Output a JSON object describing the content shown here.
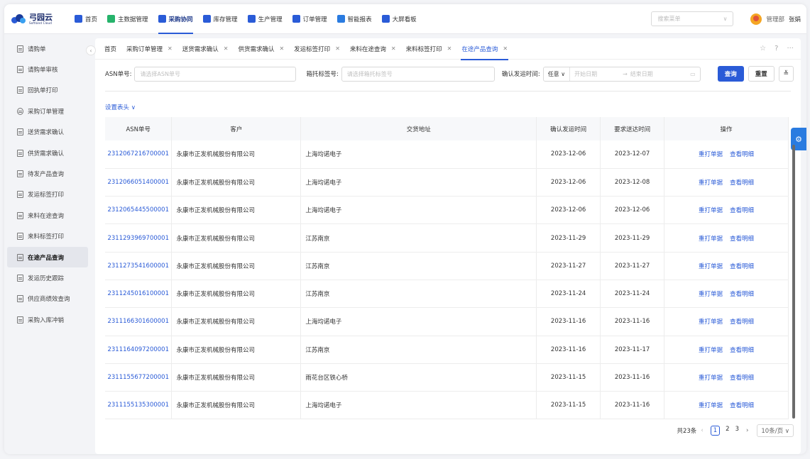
{
  "app": {
    "logo_text": "弓园云",
    "logo_sub": "Softland Cloud"
  },
  "topnav": {
    "items": [
      {
        "label": "首页",
        "icon": "home-icon",
        "color": "#2a5bd7"
      },
      {
        "label": "主数据管理",
        "icon": "database-icon",
        "color": "#26b36b"
      },
      {
        "label": "采购协同",
        "icon": "cart-icon",
        "color": "#2a5bd7"
      },
      {
        "label": "库存管理",
        "icon": "warehouse-icon",
        "color": "#2a5bd7"
      },
      {
        "label": "生产管理",
        "icon": "factory-icon",
        "color": "#2a5bd7"
      },
      {
        "label": "订单管理",
        "icon": "order-icon",
        "color": "#2a5bd7"
      },
      {
        "label": "智能报表",
        "icon": "report-icon",
        "color": "#2a7be0"
      },
      {
        "label": "大屏看板",
        "icon": "dashboard-icon",
        "color": "#2a5bd7"
      }
    ],
    "active_index": 2,
    "search_placeholder": "搜索菜单",
    "dept": "管理部",
    "user": "张娟"
  },
  "sidebar": {
    "items": [
      {
        "label": "请购单"
      },
      {
        "label": "请购单审核"
      },
      {
        "label": "回执单打印"
      },
      {
        "label": "采购订单管理"
      },
      {
        "label": "送货需求确认"
      },
      {
        "label": "供货需求确认"
      },
      {
        "label": "待发产品查询"
      },
      {
        "label": "发运标签打印"
      },
      {
        "label": "来料在途查询"
      },
      {
        "label": "来料标签打印"
      },
      {
        "label": "在途产品查询"
      },
      {
        "label": "发运历史跟踪"
      },
      {
        "label": "供应商绩效查询"
      },
      {
        "label": "采购入库冲销"
      }
    ],
    "active_index": 10
  },
  "tabs": {
    "items": [
      {
        "label": "首页",
        "closable": false
      },
      {
        "label": "采购订单管理",
        "closable": true
      },
      {
        "label": "送货需求确认",
        "closable": true
      },
      {
        "label": "供货需求确认",
        "closable": true
      },
      {
        "label": "发运标签打印",
        "closable": true
      },
      {
        "label": "来料在途查询",
        "closable": true
      },
      {
        "label": "来料标签打印",
        "closable": true
      },
      {
        "label": "在途产品查询",
        "closable": true
      }
    ],
    "active_index": 7
  },
  "filters": {
    "asn_label": "ASN单号:",
    "asn_placeholder": "请选择ASN单号",
    "box_label": "箱托标签号:",
    "box_placeholder": "请选择箱托标签号",
    "date_label": "确认发运时间:",
    "date_mode": "任意",
    "date_start": "开始日期",
    "date_sep": "→",
    "date_end": "结束日期",
    "query_label": "查询",
    "reset_label": "重置",
    "expand_icon": "double-chevron-down-icon"
  },
  "settings_label": "设置表头 ∨",
  "table": {
    "columns": [
      "ASN单号",
      "客户",
      "交货地址",
      "确认发运时间",
      "要求送达时间",
      "操作"
    ],
    "rows": [
      {
        "asn": "2312067216700001",
        "customer": "永康市正发机械股份有限公司",
        "address": "上海均诺电子",
        "ship": "2023-12-06",
        "due": "2023-12-07"
      },
      {
        "asn": "2312066051400001",
        "customer": "永康市正发机械股份有限公司",
        "address": "上海均诺电子",
        "ship": "2023-12-06",
        "due": "2023-12-08"
      },
      {
        "asn": "2312065445500001",
        "customer": "永康市正发机械股份有限公司",
        "address": "上海均诺电子",
        "ship": "2023-12-06",
        "due": "2023-12-06"
      },
      {
        "asn": "2311293969700001",
        "customer": "永康市正发机械股份有限公司",
        "address": "江苏南京",
        "ship": "2023-11-29",
        "due": "2023-11-29"
      },
      {
        "asn": "2311273541600001",
        "customer": "永康市正发机械股份有限公司",
        "address": "江苏南京",
        "ship": "2023-11-27",
        "due": "2023-11-27"
      },
      {
        "asn": "2311245016100001",
        "customer": "永康市正发机械股份有限公司",
        "address": "江苏南京",
        "ship": "2023-11-24",
        "due": "2023-11-24"
      },
      {
        "asn": "2311166301600001",
        "customer": "永康市正发机械股份有限公司",
        "address": "上海均诺电子",
        "ship": "2023-11-16",
        "due": "2023-11-16"
      },
      {
        "asn": "2311164097200001",
        "customer": "永康市正发机械股份有限公司",
        "address": "江苏南京",
        "ship": "2023-11-16",
        "due": "2023-11-17"
      },
      {
        "asn": "2311155677200001",
        "customer": "永康市正发机械股份有限公司",
        "address": "雨花台区铁心桥",
        "ship": "2023-11-15",
        "due": "2023-11-16"
      },
      {
        "asn": "2311155135300001",
        "customer": "永康市正发机械股份有限公司",
        "address": "上海均诺电子",
        "ship": "2023-11-15",
        "due": "2023-11-16"
      }
    ],
    "op_reprint": "重打单据",
    "op_detail": "查看明细"
  },
  "pager": {
    "total": "共23条",
    "pages": [
      "1",
      "2",
      "3"
    ],
    "current": "1",
    "page_size": "10条/页 ∨"
  },
  "colors": {
    "primary": "#2a5bd7",
    "link": "#2a5bd7",
    "gear_button": "#2a7be0"
  }
}
